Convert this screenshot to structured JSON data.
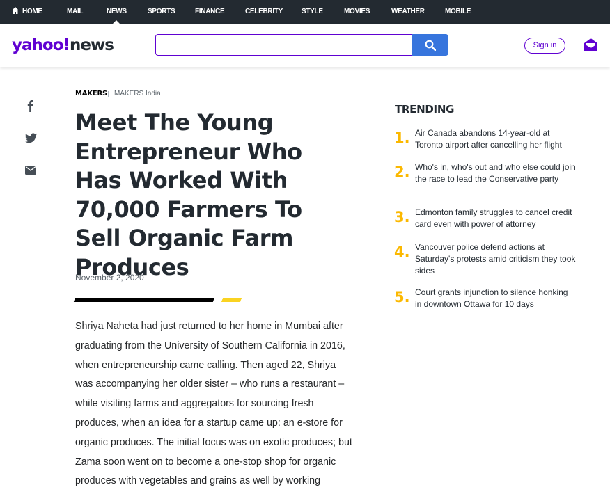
{
  "topnav": {
    "items": [
      "HOME",
      "MAIL",
      "NEWS",
      "SPORTS",
      "FINANCE",
      "CELEBRITY",
      "STYLE",
      "MOVIES",
      "WEATHER",
      "MOBILE"
    ]
  },
  "header": {
    "logo_brand": "yahoo!",
    "logo_section": "news",
    "search_placeholder": "",
    "signin_label": "Sign in"
  },
  "colors": {
    "brand_purple": "#6001d2",
    "search_blue": "#3775dd",
    "trending_yellow": "#fbb800",
    "topnav_bg": "#232a31"
  },
  "share": [
    "facebook-icon",
    "twitter-icon",
    "email-icon"
  ],
  "article": {
    "publisher_logo": "MAKERS",
    "author": "MAKERS India",
    "headline": "Meet The Young Entrepreneur Who Has Worked With 70,000 Farmers To Sell Organic Farm Produces",
    "date": "November 2, 2020",
    "body": "Shriya Naheta had just returned to her home in Mumbai after graduating from the University of Southern California in 2016, when entrepreneurship came calling. Then aged 22, Shriya was accompanying her older sister – who runs a restaurant – while visiting farms and aggregators for sourcing fresh produces, when an idea for a startup came up: an e-store for organic produces. The initial focus was on exotic produces; but Zama soon went on to become a one-stop shop for organic produces with vegetables and grains as well by working"
  },
  "trending": {
    "title": "TRENDING",
    "items": [
      {
        "num": "1.",
        "text": "Air Canada abandons 14-year-old at Toronto airport after cancelling her flight"
      },
      {
        "num": "2.",
        "text": "Who's in, who's out and who else could join the race to lead the Conservative party"
      },
      {
        "num": "3.",
        "text": "Edmonton family struggles to cancel credit card even with power of attorney"
      },
      {
        "num": "4.",
        "text": "Vancouver police defend actions at Saturday's protests amid criticism they took sides"
      },
      {
        "num": "5.",
        "text": "Court grants injunction to silence honking in downtown Ottawa for 10 days"
      }
    ]
  }
}
